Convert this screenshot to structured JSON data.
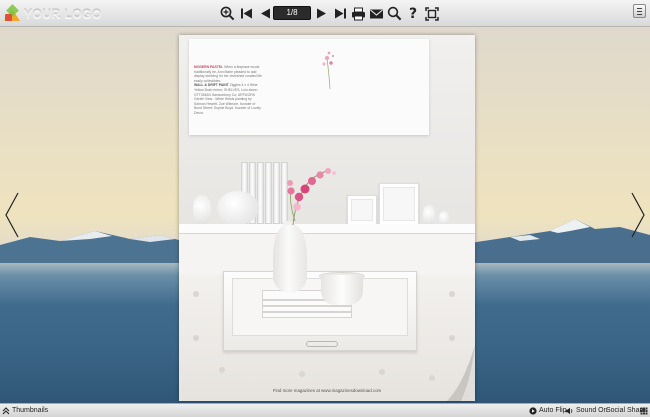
{
  "toolbar": {
    "logo_text": "YOUR LOGO",
    "page_indicator": "1/8",
    "help_glyph": "?"
  },
  "page": {
    "article": {
      "headline": "MODERN PASTEL",
      "intro": "When a fireplace would traditionally be, Ann Marie pleaded to add display shelving for her cherished curated life easily collectibles.",
      "section_label": "WALL & DRIFT PAINT",
      "section_text": "Ziggles 4 x 4 Wine Yellow Bush mirror; SHELVES, Lulu stone; OTTOMAN Samsonbury Co; ARTWORK Gentle View - White Winds painting by Salmon Hewett.",
      "closing": "Zoe Wilmore, founder of Bond Street; Sophie Boyd, founder of Lovely Decor."
    },
    "footer_link": "Find more magazines at www.magazinesdownload.com"
  },
  "bottombar": {
    "thumbnails": "Thumbnails",
    "auto_flip": "Auto Flip",
    "sound_on": "Sound On",
    "social_share": "Social Share"
  },
  "icons": {
    "zoom_in": "zoom-in-icon",
    "first_page": "first-page-icon",
    "prev_page": "prev-page-icon",
    "next_page": "next-page-icon",
    "last_page": "last-page-icon",
    "email": "email-icon",
    "print": "print-icon",
    "search": "search-icon",
    "help": "help-icon",
    "fullscreen": "fullscreen-icon",
    "menu": "menu-icon"
  },
  "colors": {
    "toolbar_bg": "#e4e4e4",
    "page_indicator_bg": "#2b2b2b",
    "headline_accent": "#d23b5f",
    "sky": "#efe3be",
    "water": "#3b6587"
  }
}
